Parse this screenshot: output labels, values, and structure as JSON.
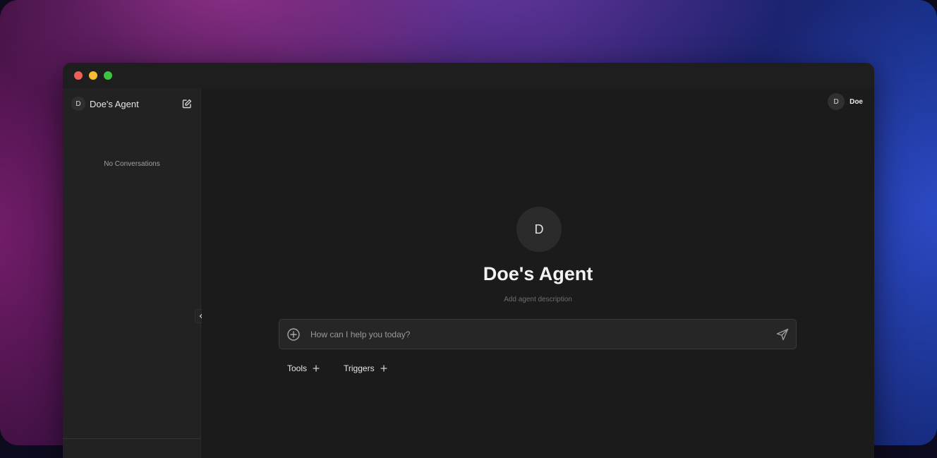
{
  "sidebar": {
    "agent_initial": "D",
    "agent_name": "Doe's Agent",
    "empty_state": "No Conversations"
  },
  "user": {
    "initial": "D",
    "name": "Doe"
  },
  "main": {
    "agent_initial": "D",
    "agent_title": "Doe's Agent",
    "agent_description_placeholder": "Add agent description",
    "chat_placeholder": "How can I help you today?",
    "tools_label": "Tools",
    "triggers_label": "Triggers"
  },
  "icons": {
    "edit": "edit-icon",
    "collapse": "chevron-left-icon",
    "add": "plus-circle-icon",
    "send": "send-icon",
    "plus": "plus-icon"
  },
  "colors": {
    "window_bg": "#1b1b1b",
    "sidebar_bg": "#222222",
    "traffic_red": "#ed5f57",
    "traffic_yellow": "#f5bd2f",
    "traffic_green": "#3dc441"
  }
}
